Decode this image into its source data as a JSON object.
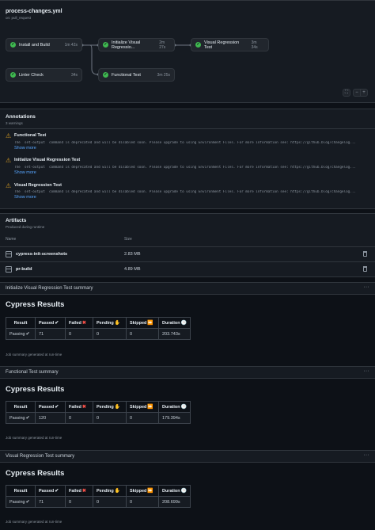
{
  "workflow": {
    "file": "process-changes.yml",
    "trigger": "on: pull_request",
    "jobs": [
      {
        "name": "Install and Build",
        "time": "1m 42s"
      },
      {
        "name": "Initialize Visual Regressio...",
        "time": "2m 27s"
      },
      {
        "name": "Visual Regression Test",
        "time": "3m 34s"
      },
      {
        "name": "Linter Check",
        "time": "34s"
      },
      {
        "name": "Functional Test",
        "time": "3m 25s"
      }
    ],
    "controls": {
      "fullscreen": "⛶",
      "zoom_out": "−",
      "zoom_in": "+"
    }
  },
  "annotations": {
    "title": "Annotations",
    "subtitle": "3 warnings",
    "items": [
      {
        "title": "Functional Test",
        "message": "The `set-output` command is deprecated and will be disabled soon. Please upgrade to using Environment Files. For more information see: https://github.blog/changelog...",
        "more": "Show more"
      },
      {
        "title": "Initialize Visual Regression Test",
        "message": "The `set-output` command is deprecated and will be disabled soon. Please upgrade to using Environment Files. For more information see: https://github.blog/changelog...",
        "more": "Show more"
      },
      {
        "title": "Visual Regression Test",
        "message": "The `set-output` command is deprecated and will be disabled soon. Please upgrade to using Environment Files. For more information see: https://github.blog/changelog...",
        "more": "Show more"
      }
    ]
  },
  "artifacts": {
    "title": "Artifacts",
    "subtitle": "Produced during runtime",
    "col_name": "Name",
    "col_size": "Size",
    "items": [
      {
        "name": "cypress-init-screenshots",
        "size": "2.83 MB"
      },
      {
        "name": "pr-build",
        "size": "4.89 MB"
      }
    ]
  },
  "summaries": [
    {
      "heading": "Initialize Visual Regression Test summary",
      "title": "Cypress Results",
      "result": "Passing",
      "passed": "71",
      "failed": "0",
      "pending": "0",
      "skipped": "0",
      "duration": "203.743s",
      "footer": "Job summary generated at run-time"
    },
    {
      "heading": "Functional Test summary",
      "title": "Cypress Results",
      "result": "Passing",
      "passed": "120",
      "failed": "0",
      "pending": "0",
      "skipped": "0",
      "duration": "179.394s",
      "footer": "Job summary generated at run-time"
    },
    {
      "heading": "Visual Regression Test summary",
      "title": "Cypress Results",
      "result": "Passing",
      "passed": "71",
      "failed": "0",
      "pending": "0",
      "skipped": "0",
      "duration": "208.699s",
      "footer": "Job summary generated at run-time"
    }
  ],
  "table_headers": {
    "result": "Result",
    "passed": "Passed",
    "failed": "Failed",
    "pending": "Pending",
    "skipped": "Skipped",
    "duration": "Duration"
  },
  "emoji": {
    "check": "✔",
    "cross": "✖",
    "pending": "✋",
    "skipped": "⏩",
    "clock": "🕒"
  },
  "menu_glyph": "···"
}
